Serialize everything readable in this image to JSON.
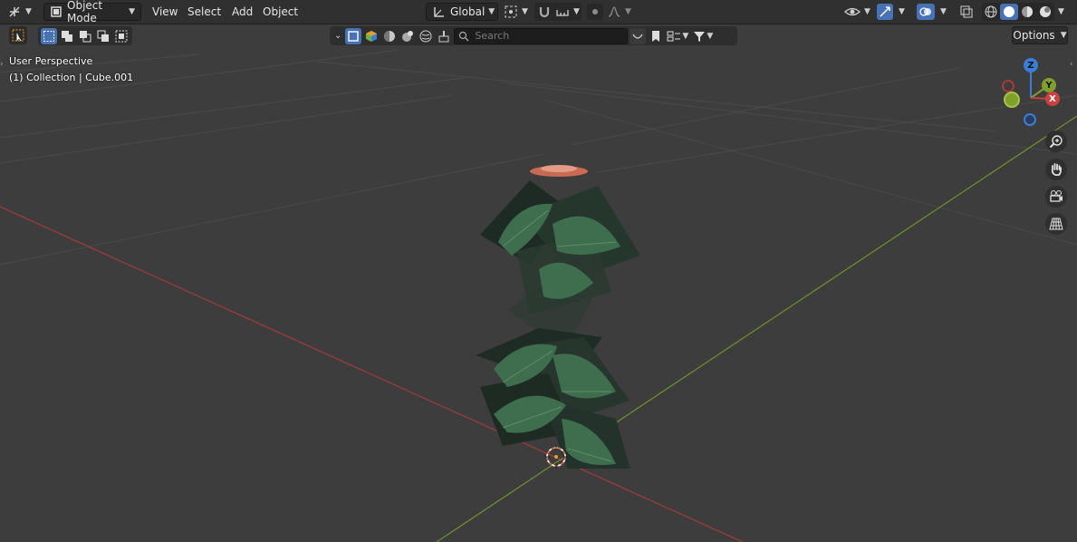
{
  "header": {
    "mode": "Object Mode",
    "menus": [
      "View",
      "Select",
      "Add",
      "Object"
    ],
    "transform_orientation": "Global"
  },
  "toolbar": {
    "search_placeholder": "Search",
    "options_label": "Options"
  },
  "viewport": {
    "view_name": "User Perspective",
    "collection_info": "(1) Collection | Cube.001"
  },
  "gizmo": {
    "axis_z": "Z",
    "axis_y": "Y",
    "axis_x": "X"
  },
  "colors": {
    "accent": "#4772b3",
    "x_axis": "#c8433f",
    "y_axis": "#7fa12b",
    "z_axis": "#3b7ed8",
    "background": "#3d3d3d"
  }
}
